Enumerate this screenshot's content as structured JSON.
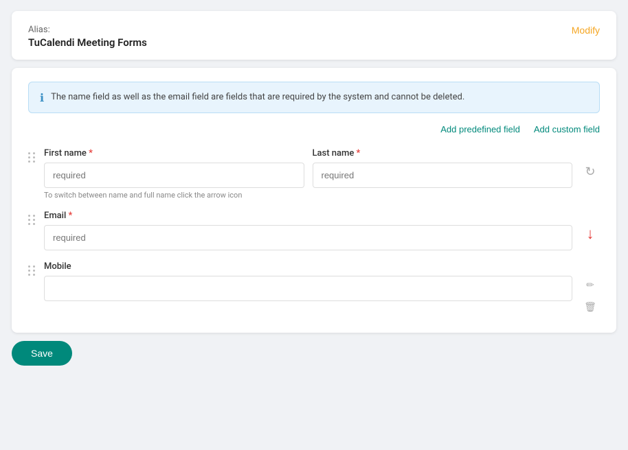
{
  "alias": {
    "label": "Alias:",
    "value": "TuCalendi Meeting Forms",
    "modify_label": "Modify"
  },
  "info_banner": {
    "text": "The name field as well as the email field are fields that are required by the system and cannot be deleted."
  },
  "actions": {
    "add_predefined": "Add predefined field",
    "add_custom": "Add custom field"
  },
  "fields": [
    {
      "id": "first_name",
      "label": "First name",
      "required": true,
      "placeholder": "required",
      "type": "name_pair",
      "pair_label": "Last name",
      "pair_placeholder": "required",
      "hint": "To switch between name and full name click the arrow icon",
      "has_refresh": true
    },
    {
      "id": "email",
      "label": "Email",
      "required": true,
      "placeholder": "required",
      "type": "single",
      "has_arrow_down": true
    },
    {
      "id": "mobile",
      "label": "Mobile",
      "required": false,
      "placeholder": "",
      "type": "single",
      "has_edit": true,
      "has_delete": true
    }
  ],
  "footer": {
    "save_label": "Save"
  }
}
